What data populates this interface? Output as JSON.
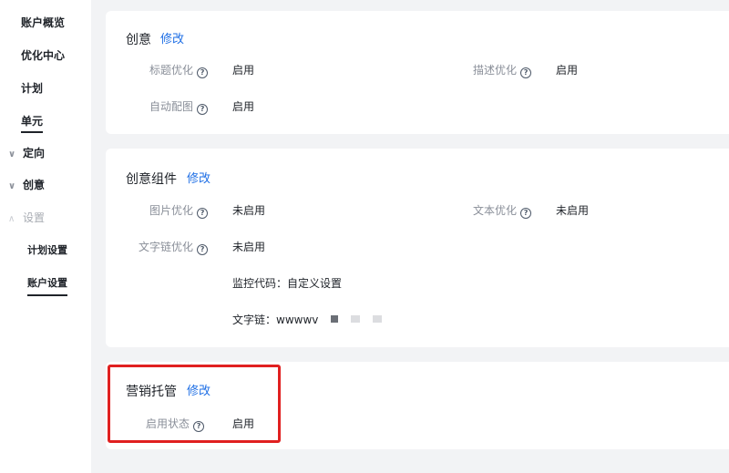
{
  "sidebar": {
    "items": [
      {
        "label": "账户概览"
      },
      {
        "label": "优化中心"
      },
      {
        "label": "计划"
      },
      {
        "label": "单元"
      },
      {
        "label": "定向"
      },
      {
        "label": "创意"
      },
      {
        "label": "设置"
      },
      {
        "label": "计划设置"
      },
      {
        "label": "账户设置"
      }
    ]
  },
  "cards": {
    "creative": {
      "title": "创意",
      "edit": "修改",
      "fields": {
        "title_opt_label": "标题优化",
        "title_opt_value": "启用",
        "desc_opt_label": "描述优化",
        "desc_opt_value": "启用",
        "auto_image_label": "自动配图",
        "auto_image_value": "启用"
      }
    },
    "components": {
      "title": "创意组件",
      "edit": "修改",
      "fields": {
        "image_opt_label": "图片优化",
        "image_opt_value": "未启用",
        "text_opt_label": "文本优化",
        "text_opt_value": "未启用",
        "textlink_opt_label": "文字链优化",
        "textlink_opt_value": "未启用",
        "monitor_code": "监控代码：自定义设置",
        "text_link": "文字链：wwwwv"
      }
    },
    "marketing": {
      "title": "营销托管",
      "edit": "修改",
      "fields": {
        "status_label": "启用状态",
        "status_value": "启用"
      }
    }
  },
  "icons": {
    "help": "?",
    "chevron_down": "∨",
    "chevron_up": "∧"
  },
  "colors": {
    "link": "#1f6fe5",
    "highlight": "#e02020"
  }
}
